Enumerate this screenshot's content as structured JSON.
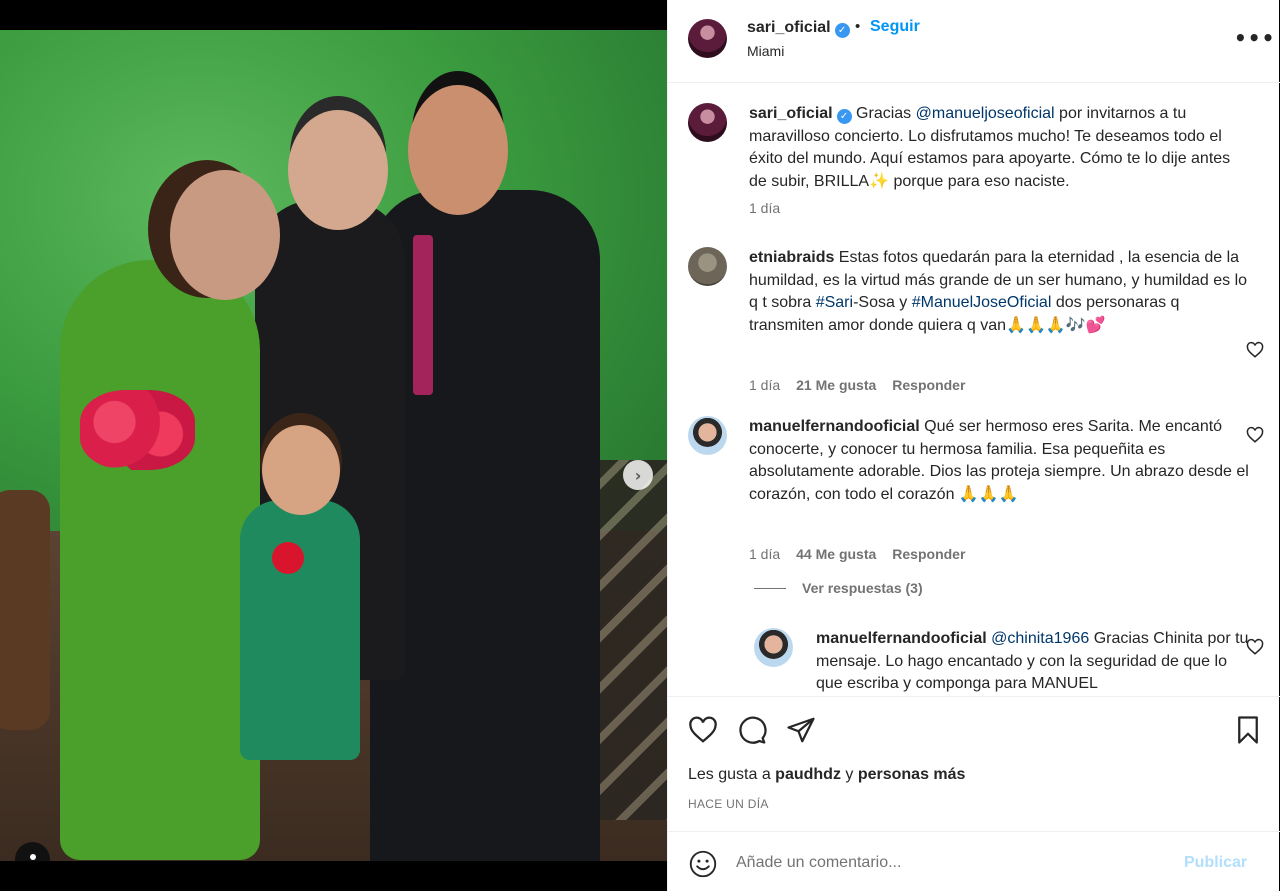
{
  "post": {
    "username": "sari_oficial",
    "separator": "•",
    "follow_label": "Seguir",
    "location": "Miami",
    "more_label": "•••"
  },
  "media": {
    "next_arrow": "›",
    "slide_count": 4,
    "active_slide": 1
  },
  "caption": {
    "username": "sari_oficial",
    "text_before": " Gracias ",
    "mention": "@manueljoseoficial",
    "text_after": " por invitarnos a tu maravilloso concierto. Lo disfrutamos mucho! Te deseamos todo el éxito del mundo. Aquí estamos para apoyarte. Cómo te lo dije antes de subir, BRILLA✨ porque para eso naciste.",
    "time": "1 día"
  },
  "comments": [
    {
      "username": "etniabraids",
      "text_1": " Estas fotos quedarán para la eternidad , la esencia de la humildad, es la virtud más grande de un ser humano, y humildad es lo q t sobra ",
      "tag_1": "#Sari",
      "text_2": "-Sosa y ",
      "tag_2": "#ManuelJoseOficial",
      "text_3": " dos personaras q transmiten amor donde quiera q van🙏🙏🙏🎶💕",
      "time": "1 día",
      "likes": "21 Me gusta",
      "reply_label": "Responder"
    },
    {
      "username": "manuelfernandooficial",
      "text": " Qué ser hermoso eres Sarita. Me encantó conocerte, y conocer tu hermosa familia. Esa pequeñita es absolutamente adorable. Dios las proteja siempre. Un abrazo desde el corazón, con todo el corazón 🙏🙏🙏",
      "time": "1 día",
      "likes": "44 Me gusta",
      "reply_label": "Responder"
    }
  ],
  "view_replies": "Ver respuestas (3)",
  "reply": {
    "username": "manuelfernandooficial",
    "mention": "@chinita1966",
    "text": " Gracias Chinita por tu mensaje. Lo hago encantado y con la seguridad de que lo que escriba y componga para MANUEL"
  },
  "likes_line": {
    "prefix": "Les gusta a ",
    "user": "paudhdz",
    "middle": " y ",
    "others": "personas más"
  },
  "posted_time": "HACE UN DÍA",
  "add_comment": {
    "placeholder": "Añade un comentario...",
    "publish_label": "Publicar"
  },
  "colors": {
    "accent": "#0095f6",
    "link": "#00376b",
    "muted": "#737373",
    "publish_disabled": "#b2dffc"
  },
  "icons": [
    "verified-icon",
    "more-icon",
    "next-arrow-icon",
    "user-tag-icon",
    "heart-icon",
    "comment-icon",
    "share-icon",
    "bookmark-icon",
    "emoji-icon"
  ]
}
